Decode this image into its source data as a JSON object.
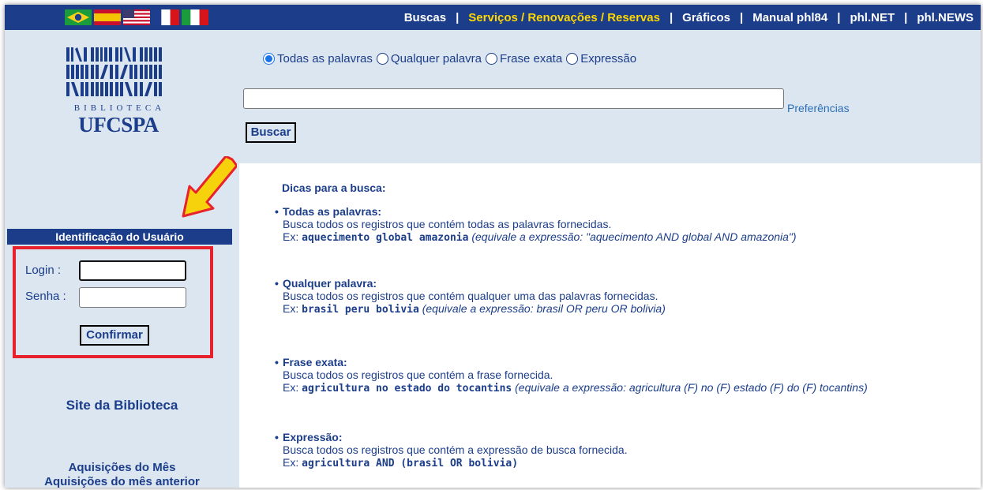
{
  "nav": {
    "flags": [
      "brazil-flag",
      "spain-flag",
      "usa-flag",
      "france-flag",
      "italy-flag"
    ],
    "links": [
      {
        "label": "Buscas",
        "active": false
      },
      {
        "label": "Serviços / Renovações / Reservas",
        "active": true
      },
      {
        "label": "Gráficos",
        "active": false
      },
      {
        "label": "Manual phl84",
        "active": false
      },
      {
        "label": "phl.NET",
        "active": false
      },
      {
        "label": "phl.NEWS",
        "active": false
      }
    ],
    "separator": "|"
  },
  "logo": {
    "subtitle": "BIBLIOTECA",
    "name": "UFCSPA"
  },
  "login": {
    "header": "Identificação do Usuário",
    "login_label": "Login :",
    "password_label": "Senha :",
    "login_value": "",
    "password_value": "",
    "confirm_label": "Confirmar"
  },
  "sidebar_links": {
    "site": "Site da Biblioteca",
    "acq_month": "Aquisições do Mês",
    "acq_prev": "Aquisições do mês anterior"
  },
  "search": {
    "options": [
      {
        "label": "Todas as palavras",
        "checked": true
      },
      {
        "label": "Qualquer palavra",
        "checked": false
      },
      {
        "label": "Frase exata",
        "checked": false
      },
      {
        "label": "Expressão",
        "checked": false
      }
    ],
    "query": "",
    "preferences_label": "Preferências",
    "button_label": "Buscar"
  },
  "tips": {
    "title": "Dicas para a busca:",
    "bullet": "•",
    "items": [
      {
        "title": "Todas as palavras:",
        "desc": "Busca todos os registros que contém todas as palavras fornecidas.",
        "ex_label": "Ex:",
        "example": "aquecimento global amazonia",
        "note": "(equivale a expressão: \"aquecimento AND global AND amazonia\")"
      },
      {
        "title": "Qualquer palavra:",
        "desc": "Busca todos os registros que contém qualquer uma das palavras fornecidas.",
        "ex_label": "Ex:",
        "example": "brasil peru bolivia",
        "note": "(equivale a expressão: brasil OR peru OR bolivia)"
      },
      {
        "title": "Frase exata:",
        "desc": "Busca todos os registros que contém a frase fornecida.",
        "ex_label": "Ex:",
        "example": "agricultura no estado do tocantins",
        "note": "(equivale a expressão: agricultura (F) no (F) estado (F) do (F) tocantins)"
      },
      {
        "title": "Expressão:",
        "desc": "Busca todos os registros que contém a expressão de busca fornecida.",
        "ex_label": "Ex:",
        "example": "agricultura AND (brasil OR bolivia)",
        "note": ""
      }
    ]
  },
  "colors": {
    "brand_blue": "#1b3d8a",
    "panel_bg": "#dce6f1",
    "highlight_red": "#e8222c",
    "active_link": "#ffd700",
    "arrow": "#f5d20b"
  }
}
